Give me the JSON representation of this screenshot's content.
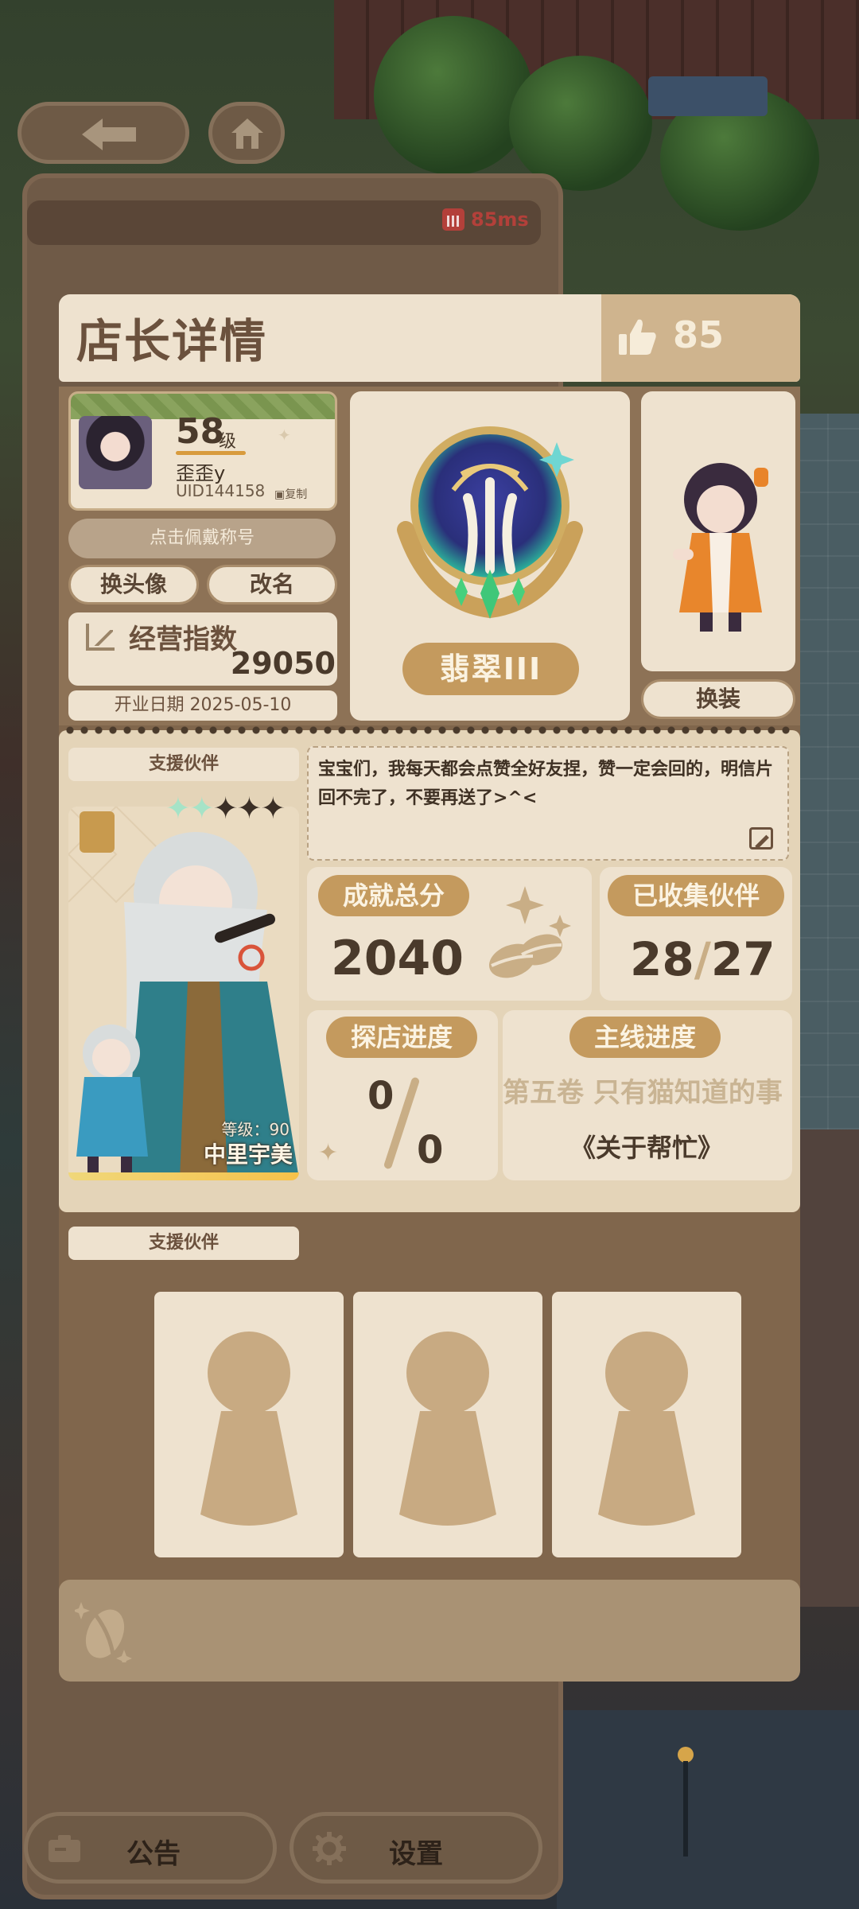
{
  "status": {
    "ping": "85ms"
  },
  "header": {
    "title": "店长详情",
    "likes": "85"
  },
  "profile": {
    "level": "58",
    "level_suffix": "级",
    "name": "歪歪y",
    "uid": "UID144158",
    "copy_label": "复制",
    "title_button": "点击佩戴称号",
    "change_avatar": "换头像",
    "rename": "改名",
    "business_index_label": "经营指数",
    "business_index_value": "29050",
    "open_date": "开业日期 2025-05-10"
  },
  "rank": {
    "name": "翡翠III"
  },
  "outfit": {
    "button": "换装"
  },
  "support": {
    "label": "支援伙伴",
    "partner_level": "等级：90",
    "partner_name": "中里宇美",
    "stars_filled": 2,
    "stars_total": 5
  },
  "message": "宝宝们，我每天都会点赞全好友捏，赞一定会回的，明信片回不完了，不要再送了>^<",
  "stats": {
    "achievement_label": "成就总分",
    "achievement_value": "2040",
    "collected_label": "已收集伙伴",
    "collected_current": "28",
    "collected_total": "27",
    "explore_label": "探店进度",
    "explore_current": "0",
    "explore_total": "0",
    "main_label": "主线进度",
    "main_chapter": "第五卷 只有猫知道的事",
    "main_episode": "《关于帮忙》"
  },
  "helpers": {
    "label": "支援伙伴"
  },
  "footer": {
    "notice": "公告",
    "settings": "设置"
  },
  "colors": {
    "card_cream": "#eee2cf",
    "accent_gold": "#c49a5e",
    "panel_brown": "#80664c",
    "ping_red": "#b3403a"
  },
  "icons": [
    "back-arrow-icon",
    "home-icon",
    "signal-icon",
    "thumbs-up-icon",
    "chart-icon",
    "edit-icon",
    "coffee-beans-icon",
    "notice-icon",
    "gear-icon"
  ]
}
